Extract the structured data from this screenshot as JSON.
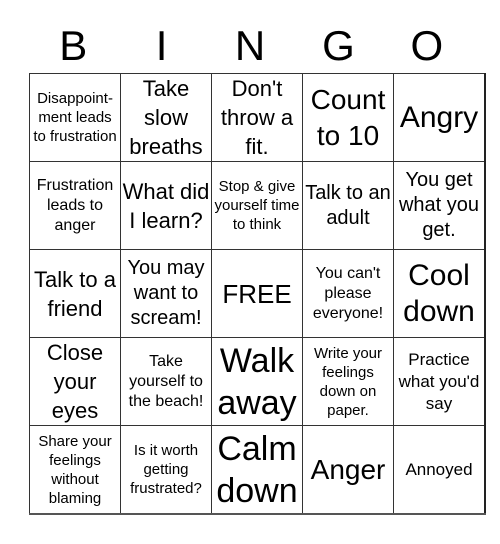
{
  "header": [
    "B",
    "I",
    "N",
    "G",
    "O"
  ],
  "rows": [
    [
      {
        "text": "Disappoint-ment leads to frustration",
        "size": "s15"
      },
      {
        "text": "Take slow breaths",
        "size": "s22"
      },
      {
        "text": "Don't throw a fit.",
        "size": "s22"
      },
      {
        "text": "Count to 10",
        "size": "s28"
      },
      {
        "text": "Angry",
        "size": "s30"
      }
    ],
    [
      {
        "text": "Frustration leads to anger",
        "size": "s16"
      },
      {
        "text": "What did I learn?",
        "size": "s22"
      },
      {
        "text": "Stop & give yourself time to think",
        "size": "s15"
      },
      {
        "text": "Talk to an adult",
        "size": "s20"
      },
      {
        "text": "You get what you get.",
        "size": "s20"
      }
    ],
    [
      {
        "text": "Talk to a friend",
        "size": "s22"
      },
      {
        "text": "You may want to scream!",
        "size": "s20"
      },
      {
        "text": "FREE",
        "size": "s26"
      },
      {
        "text": "You can't please everyone!",
        "size": "s16"
      },
      {
        "text": "Cool down",
        "size": "s30"
      }
    ],
    [
      {
        "text": "Close your eyes",
        "size": "s22"
      },
      {
        "text": "Take yourself to the beach!",
        "size": "s16"
      },
      {
        "text": "Walk away",
        "size": "s34"
      },
      {
        "text": "Write your feelings down on paper.",
        "size": "s15"
      },
      {
        "text": "Practice what you'd say",
        "size": "s17"
      }
    ],
    [
      {
        "text": "Share your feelings without blaming",
        "size": "s15"
      },
      {
        "text": "Is it worth getting frustrated?",
        "size": "s15"
      },
      {
        "text": "Calm down",
        "size": "s34"
      },
      {
        "text": "Anger",
        "size": "s28"
      },
      {
        "text": "Annoyed",
        "size": "s17"
      }
    ]
  ]
}
